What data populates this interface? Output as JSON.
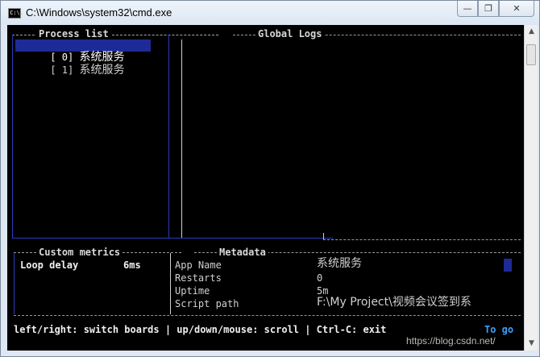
{
  "window": {
    "title": "C:\\Windows\\system32\\cmd.exe",
    "icon_text": "C:\\."
  },
  "boxes": {
    "process_list": "Process list",
    "global_logs": "Global Logs",
    "custom_metrics": "Custom metrics",
    "metadata": "Metadata"
  },
  "processes": [
    {
      "index": "[ 0]",
      "name": "系统服务",
      "selected": true
    },
    {
      "index": "[ 1]",
      "name": "系统服务",
      "selected": false
    }
  ],
  "metrics": {
    "label": "Loop delay",
    "value": "6ms"
  },
  "metadata": [
    {
      "key": "App Name",
      "value": "系统服务"
    },
    {
      "key": "Restarts",
      "value": "0"
    },
    {
      "key": "Uptime",
      "value": "5m"
    },
    {
      "key": "Script path",
      "value": "F:\\My Project\\视频会议签到系"
    }
  ],
  "footer": {
    "help": "left/right: switch boards | up/down/mouse: scroll | Ctrl-C: exit",
    "to_go": "To go"
  },
  "watermark": "https://blog.csdn.net/",
  "colors": {
    "console_bg": "#000000",
    "border_blue": "#2a3ab8",
    "selection": "#1e2a96",
    "accent_link": "#3aa0ff"
  }
}
